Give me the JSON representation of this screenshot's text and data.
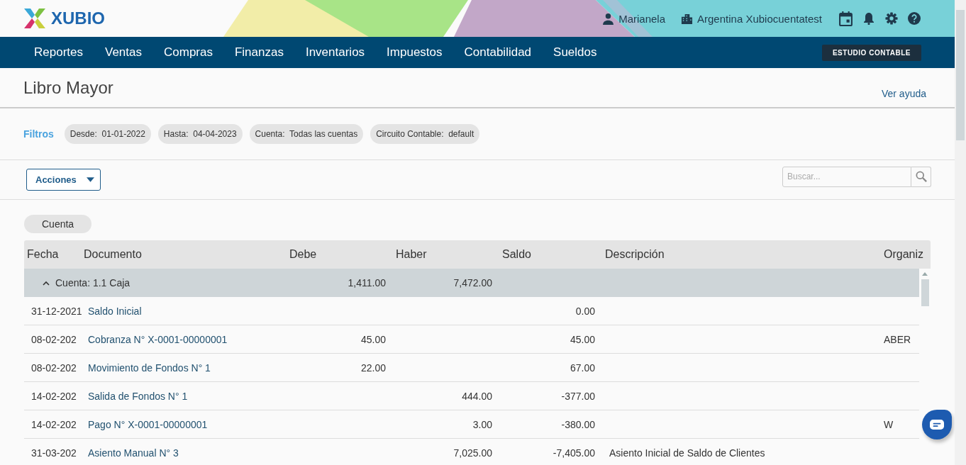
{
  "header": {
    "logo": "XUBIO",
    "user": "Marianela",
    "company": "Argentina Xubiocuentatest"
  },
  "nav": {
    "items": [
      "Reportes",
      "Ventas",
      "Compras",
      "Finanzas",
      "Inventarios",
      "Impuestos",
      "Contabilidad",
      "Sueldos"
    ],
    "badge": "ESTUDIO CONTABLE"
  },
  "page": {
    "title": "Libro Mayor",
    "help_link": "Ver ayuda"
  },
  "filters": {
    "label": "Filtros",
    "chips": [
      "Desde:  01-01-2022",
      "Hasta:  04-04-2023",
      "Cuenta:  Todas las cuentas",
      "Circuito Contable:  default"
    ]
  },
  "toolbar": {
    "actions_button": "Acciones",
    "search": {
      "placeholder": "Buscar..."
    }
  },
  "group_chips": [
    "Cuenta"
  ],
  "table": {
    "columns": [
      "Fecha",
      "Documento",
      "Debe",
      "Haber",
      "Saldo",
      "Descripción",
      "Organiz"
    ],
    "groups": [
      {
        "label": "Cuenta: 1.1 Caja",
        "expanded": true,
        "debe": "1,411.00",
        "haber": "7,472.00",
        "rows": [
          {
            "fecha": "31-12-2021",
            "documento": "Saldo Inicial",
            "saldo": "0.00"
          },
          {
            "fecha": "08-02-202",
            "documento": "Cobranza N° X-0001-00000001",
            "debe": "45.00",
            "saldo": "45.00",
            "column_7": "ABER"
          },
          {
            "fecha": "08-02-202",
            "documento": "Movimiento de Fondos N° 1",
            "debe": "22.00",
            "saldo": "67.00"
          },
          {
            "fecha": "14-02-202",
            "documento": "Salida de Fondos N° 1",
            "haber": "444.00",
            "saldo": "-377.00"
          },
          {
            "fecha": "14-02-202",
            "documento": "Pago N° X-0001-00000001",
            "haber": "3.00",
            "saldo": "-380.00",
            "column_7": "W"
          },
          {
            "fecha": "31-03-202",
            "documento": "Asiento Manual N° 3",
            "haber": "7,025.00",
            "saldo": "-7,405.00",
            "descripcion": "Asiento Inicial de Saldo de Clientes"
          }
        ]
      }
    ]
  }
}
